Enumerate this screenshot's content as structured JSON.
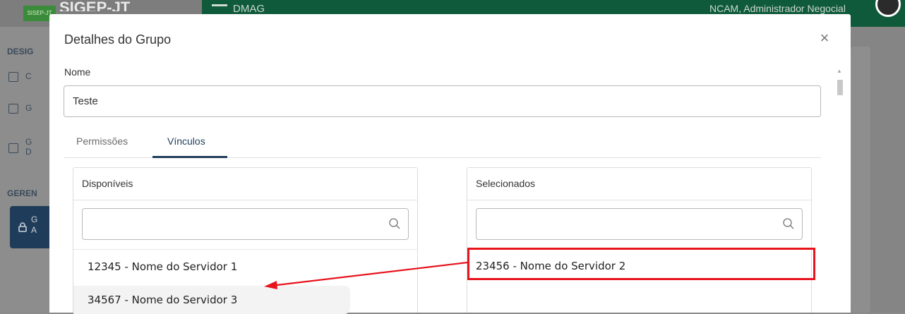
{
  "app": {
    "logo_text": "SISEP-JT",
    "brand": "SIGEP-JT",
    "module": "DMAG",
    "user": "NCAM, Administrador Negocial",
    "sidebar": {
      "section1": "DESIG",
      "item1": "C",
      "item2": "G",
      "item3": "G",
      "item3_line2": "D",
      "section2": "GEREN",
      "active_item": "G",
      "active_item_line2": "A"
    }
  },
  "modal": {
    "title": "Detalhes do Grupo",
    "close_symbol": "×",
    "name_label": "Nome",
    "name_value": "Teste",
    "tabs": [
      {
        "label": "Permissões",
        "active": false
      },
      {
        "label": "Vínculos",
        "active": true
      }
    ],
    "available": {
      "title": "Disponíveis",
      "search_placeholder": "",
      "items": [
        "12345 - Nome do Servidor 1",
        "34567 - Nome do Servidor 3"
      ]
    },
    "selected": {
      "title": "Selecionados",
      "search_placeholder": "",
      "items": [
        "23456 - Nome do Servidor 2"
      ]
    }
  },
  "colors": {
    "accent": "#1f3d5a",
    "annotation": "#e8141c",
    "topbar": "#0f5a3a"
  }
}
